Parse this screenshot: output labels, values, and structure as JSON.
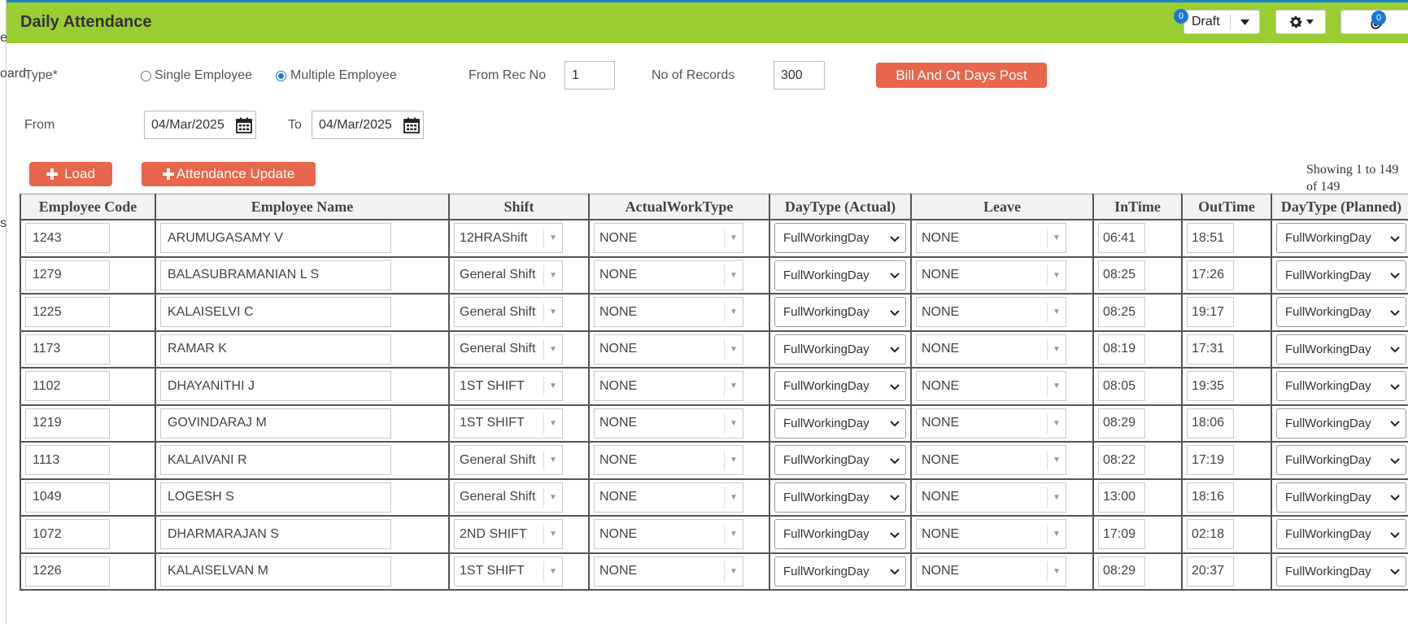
{
  "page": {
    "title": "Daily Attendance"
  },
  "left_fragments": [
    "e",
    "oard",
    "s"
  ],
  "toolbar": {
    "draft_label": "Draft",
    "draft_badge": "0",
    "attach_badge": "0"
  },
  "form": {
    "type_label": "Type*",
    "single_label": "Single Employee",
    "multiple_label": "Multiple Employee",
    "from_rec_label": "From Rec No",
    "from_rec_value": "1",
    "no_records_label": "No of Records",
    "no_records_value": "300",
    "post_button": "Bill And Ot Days Post",
    "from_label": "From",
    "from_date": "04/Mar/2025",
    "to_label": "To",
    "to_date": "04/Mar/2025",
    "load_button": "Load",
    "update_button": "Attendance Update",
    "showing_text": "Showing 1 to 149 of 149"
  },
  "table": {
    "headers": [
      "Employee Code",
      "Employee Name",
      "Shift",
      "ActualWorkType",
      "DayType (Actual)",
      "Leave",
      "InTime",
      "OutTime",
      "DayType (Planned)"
    ],
    "rows": [
      {
        "code": "1243",
        "name": "ARUMUGASAMY V",
        "shift": "12HRAShift",
        "work": "NONE",
        "day_actual": "FullWorkingDay",
        "leave": "NONE",
        "in": "06:41",
        "out": "18:51",
        "day_planned": "FullWorkingDay"
      },
      {
        "code": "1279",
        "name": "BALASUBRAMANIAN L S",
        "shift": "General Shift",
        "work": "NONE",
        "day_actual": "FullWorkingDay",
        "leave": "NONE",
        "in": "08:25",
        "out": "17:26",
        "day_planned": "FullWorkingDay"
      },
      {
        "code": "1225",
        "name": "KALAISELVI C",
        "shift": "General Shift",
        "work": "NONE",
        "day_actual": "FullWorkingDay",
        "leave": "NONE",
        "in": "08:25",
        "out": "19:17",
        "day_planned": "FullWorkingDay"
      },
      {
        "code": "1173",
        "name": "RAMAR K",
        "shift": "General Shift",
        "work": "NONE",
        "day_actual": "FullWorkingDay",
        "leave": "NONE",
        "in": "08:19",
        "out": "17:31",
        "day_planned": "FullWorkingDay"
      },
      {
        "code": "1102",
        "name": "DHAYANITHI J",
        "shift": "1ST SHIFT",
        "work": "NONE",
        "day_actual": "FullWorkingDay",
        "leave": "NONE",
        "in": "08:05",
        "out": "19:35",
        "day_planned": "FullWorkingDay"
      },
      {
        "code": "1219",
        "name": "GOVINDARAJ M",
        "shift": "1ST SHIFT",
        "work": "NONE",
        "day_actual": "FullWorkingDay",
        "leave": "NONE",
        "in": "08:29",
        "out": "18:06",
        "day_planned": "FullWorkingDay"
      },
      {
        "code": "1113",
        "name": "KALAIVANI R",
        "shift": "General Shift",
        "work": "NONE",
        "day_actual": "FullWorkingDay",
        "leave": "NONE",
        "in": "08:22",
        "out": "17:19",
        "day_planned": "FullWorkingDay"
      },
      {
        "code": "1049",
        "name": "LOGESH S",
        "shift": "General Shift",
        "work": "NONE",
        "day_actual": "FullWorkingDay",
        "leave": "NONE",
        "in": "13:00",
        "out": "18:16",
        "day_planned": "FullWorkingDay"
      },
      {
        "code": "1072",
        "name": "DHARMARAJAN S",
        "shift": "2ND SHIFT",
        "work": "NONE",
        "day_actual": "FullWorkingDay",
        "leave": "NONE",
        "in": "17:09",
        "out": "02:18",
        "day_planned": "FullWorkingDay"
      },
      {
        "code": "1226",
        "name": "KALAISELVAN M",
        "shift": "1ST SHIFT",
        "work": "NONE",
        "day_actual": "FullWorkingDay",
        "leave": "NONE",
        "in": "08:29",
        "out": "20:37",
        "day_planned": "FullWorkingDay"
      }
    ]
  },
  "colors": {
    "header_bg": "#9acd32",
    "accent_red": "#e8664c",
    "badge_blue": "#1a78d6",
    "top_line": "#1e88c8"
  }
}
